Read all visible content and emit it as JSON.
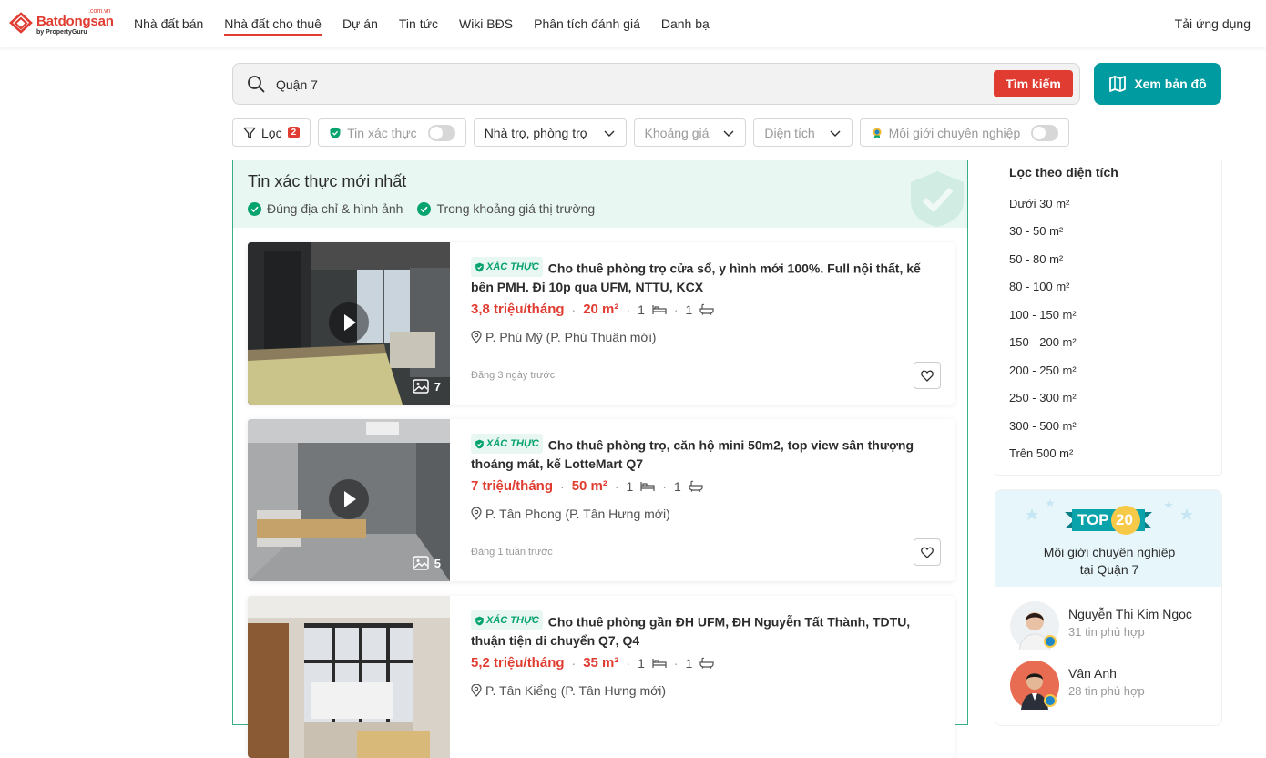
{
  "header": {
    "brand": "Batdongsan",
    "brand_sub": "by PropertyGuru",
    "brand_domain": ".com.vn",
    "nav": [
      {
        "label": "Nhà đất bán"
      },
      {
        "label": "Nhà đất cho thuê"
      },
      {
        "label": "Dự án"
      },
      {
        "label": "Tin tức"
      },
      {
        "label": "Wiki BĐS"
      },
      {
        "label": "Phân tích đánh giá"
      },
      {
        "label": "Danh bạ"
      }
    ],
    "app_link": "Tải ứng dụng"
  },
  "search": {
    "value": "Quận 7",
    "button": "Tìm kiếm",
    "map_button": "Xem bản đồ"
  },
  "filters": {
    "filter_label": "Lọc",
    "filter_count": "2",
    "verified_label": "Tin xác thực",
    "type_label": "Nhà trọ, phòng trọ",
    "price_label": "Khoảng giá",
    "area_label": "Diện tích",
    "agent_label": "Môi giới chuyên nghiệp"
  },
  "verified_section": {
    "title": "Tin xác thực mới nhất",
    "check1": "Đúng địa chỉ & hình ảnh",
    "check2": "Trong khoảng giá thị trường"
  },
  "listings": [
    {
      "badge": "XÁC THỰC",
      "title": "Cho thuê phòng trọ cửa sổ, y hình mới 100%. Full nội thất, kế bên PMH. Đi 10p qua UFM, NTTU, KCX",
      "price": "3,8 triệu/tháng",
      "area": "20 m²",
      "beds": "1",
      "baths": "1",
      "location": "P. Phú Mỹ (P. Phú Thuận mới)",
      "posted": "Đăng 3 ngày trước",
      "image_count": "7"
    },
    {
      "badge": "XÁC THỰC",
      "title": "Cho thuê phòng trọ, căn hộ mini 50m2, top view sân thượng thoáng mát, kế LotteMart Q7",
      "price": "7 triệu/tháng",
      "area": "50 m²",
      "beds": "1",
      "baths": "1",
      "location": "P. Tân Phong (P. Tân Hưng mới)",
      "posted": "Đăng 1 tuần trước",
      "image_count": "5"
    },
    {
      "badge": "XÁC THỰC",
      "title": "Cho thuê phòng gần ĐH UFM, ĐH Nguyễn Tất Thành, TDTU, thuận tiện di chuyển Q7, Q4",
      "price": "5,2 triệu/tháng",
      "area": "35 m²",
      "beds": "1",
      "baths": "1",
      "location": "P. Tân Kiểng (P. Tân Hưng mới)",
      "posted": "",
      "image_count": ""
    }
  ],
  "area_filter": {
    "title": "Lọc theo diện tích",
    "items": [
      "Dưới 30 m²",
      "30 - 50 m²",
      "50 - 80 m²",
      "80 - 100 m²",
      "100 - 150 m²",
      "150 - 200 m²",
      "200 - 250 m²",
      "250 - 300 m²",
      "300 - 500 m²",
      "Trên 500 m²"
    ]
  },
  "top_agents": {
    "badge_top": "TOP",
    "badge_num": "20",
    "subtitle_line1": "Môi giới chuyên nghiệp",
    "subtitle_line2": "tại Quận 7",
    "agents": [
      {
        "name": "Nguyễn Thị Kim Ngọc",
        "count": "31 tin phù hợp"
      },
      {
        "name": "Vân Anh",
        "count": "28 tin phù hợp"
      }
    ]
  },
  "colors": {
    "brand": "#e03c31",
    "teal": "#009ba1",
    "verified": "#06a36e"
  }
}
